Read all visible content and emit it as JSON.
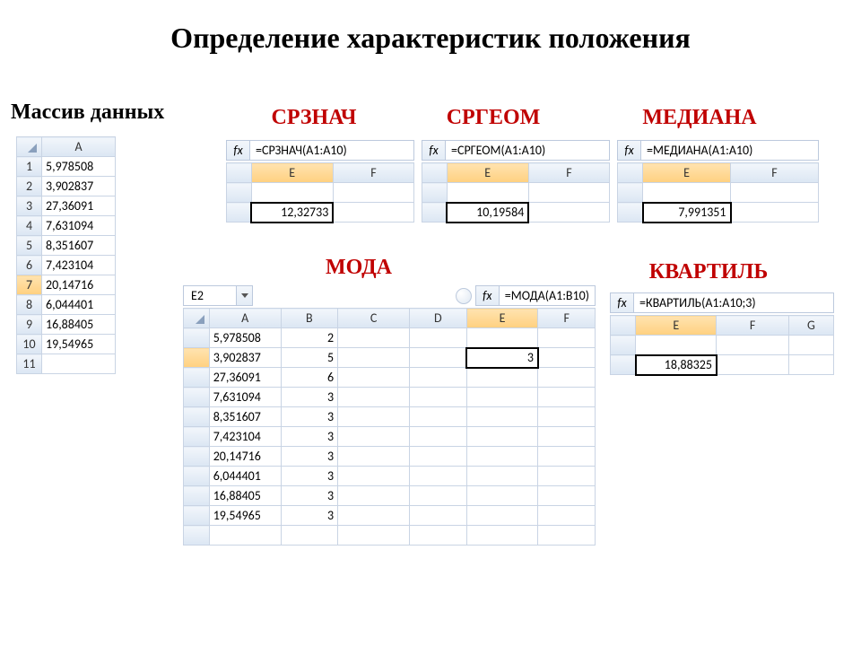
{
  "title": "Определение характеристик положения",
  "labels": {
    "dataset": "Массив данных",
    "srznach": "СРЗНАЧ",
    "srgeom": "СРГЕОМ",
    "median": "МЕДИАНА",
    "mode": "МОДА",
    "quartile": "КВАРТИЛЬ"
  },
  "cols": {
    "A": "A",
    "B": "B",
    "C": "C",
    "D": "D",
    "E": "E",
    "F": "F",
    "G": "G"
  },
  "dataset": {
    "rows": [
      {
        "n": "1",
        "v": "5,978508"
      },
      {
        "n": "2",
        "v": "3,902837"
      },
      {
        "n": "3",
        "v": "27,36091"
      },
      {
        "n": "4",
        "v": "7,631094"
      },
      {
        "n": "5",
        "v": "8,351607"
      },
      {
        "n": "6",
        "v": "7,423104"
      },
      {
        "n": "7",
        "v": "20,14716"
      },
      {
        "n": "8",
        "v": "6,044401"
      },
      {
        "n": "9",
        "v": "16,88405"
      },
      {
        "n": "10",
        "v": "19,54965"
      },
      {
        "n": "11",
        "v": ""
      }
    ]
  },
  "srznach": {
    "formula": "=СРЗНАЧ(A1:A10)",
    "result": "12,32733"
  },
  "srgeom": {
    "formula": "=СРГЕОМ(A1:A10)",
    "result": "10,19584"
  },
  "median": {
    "formula": "=МЕДИАНА(A1:A10)",
    "result": "7,991351"
  },
  "quartile": {
    "formula": "=КВАРТИЛЬ(A1:A10;3)",
    "result": "18,88325"
  },
  "mode": {
    "namebox": "E2",
    "formula": "=МОДА(A1:B10)",
    "result": "3",
    "rows": [
      {
        "a": "5,978508",
        "b": "2"
      },
      {
        "a": "3,902837",
        "b": "5"
      },
      {
        "a": "27,36091",
        "b": "6"
      },
      {
        "a": "7,631094",
        "b": "3"
      },
      {
        "a": "8,351607",
        "b": "3"
      },
      {
        "a": "7,423104",
        "b": "3"
      },
      {
        "a": "20,14716",
        "b": "3"
      },
      {
        "a": "6,044401",
        "b": "3"
      },
      {
        "a": "16,88405",
        "b": "3"
      },
      {
        "a": "19,54965",
        "b": "3"
      }
    ]
  },
  "fx": "fx"
}
